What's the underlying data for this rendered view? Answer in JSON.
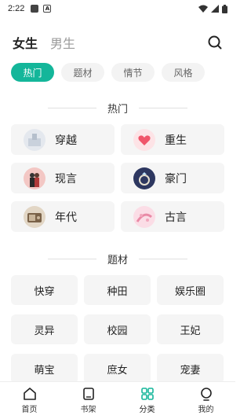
{
  "status_bar": {
    "time": "2:22",
    "badge": "A"
  },
  "header": {
    "tabs": [
      {
        "label": "女生"
      },
      {
        "label": "男生"
      }
    ]
  },
  "chips": [
    {
      "label": "热门"
    },
    {
      "label": "题材"
    },
    {
      "label": "情节"
    },
    {
      "label": "风格"
    }
  ],
  "hot_section": {
    "title": "热门",
    "items": [
      {
        "label": "穿越"
      },
      {
        "label": "重生"
      },
      {
        "label": "现言"
      },
      {
        "label": "豪门"
      },
      {
        "label": "年代"
      },
      {
        "label": "古言"
      }
    ]
  },
  "material_section": {
    "title": "题材",
    "items": [
      {
        "label": "快穿"
      },
      {
        "label": "种田"
      },
      {
        "label": "娱乐圈"
      },
      {
        "label": "灵异"
      },
      {
        "label": "校园"
      },
      {
        "label": "王妃"
      },
      {
        "label": "萌宝"
      },
      {
        "label": "庶女"
      },
      {
        "label": "宠妻"
      }
    ]
  },
  "bottom_nav": [
    {
      "label": "首页",
      "icon": "home-icon"
    },
    {
      "label": "书架",
      "icon": "bookshelf-icon"
    },
    {
      "label": "分类",
      "icon": "category-icon"
    },
    {
      "label": "我的",
      "icon": "profile-icon"
    }
  ],
  "colors": {
    "accent": "#14b69a",
    "card_bg": "#f5f5f5",
    "chip_bg": "#f3f3f3"
  }
}
